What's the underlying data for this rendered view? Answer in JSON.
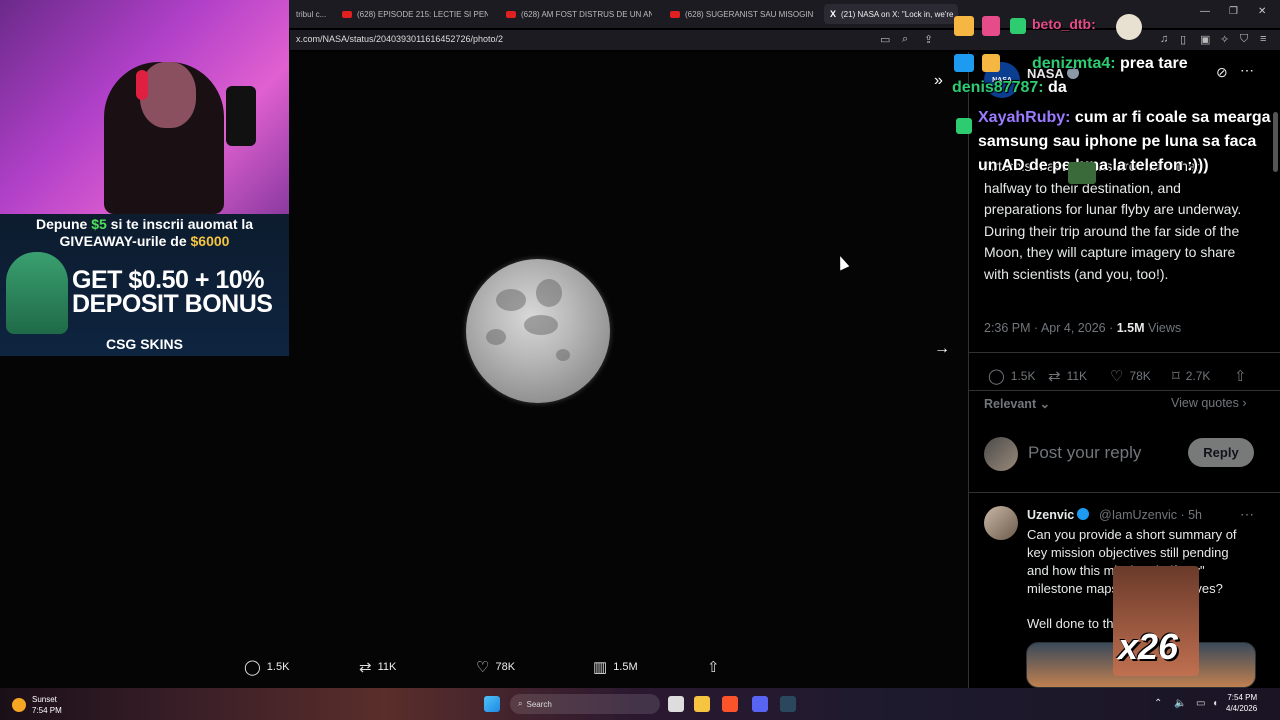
{
  "browser": {
    "tabs": [
      {
        "label": "tribul c..."
      },
      {
        "label": "(628) EPISODE 215: LECTIE SI PENTRU"
      },
      {
        "label": "(628) AM FOST DISTRUS DE UN ANT"
      },
      {
        "label": "(628) SUGERANIST SAU MISOGIN? |"
      },
      {
        "label": "(21) NASA on X: \"Lock in, we're"
      }
    ],
    "url": "x.com/NASA/status/2040393011616452726/photo/2"
  },
  "photo_actions": {
    "replies": "1.5K",
    "reposts": "11K",
    "likes": "78K",
    "views": "1.5M"
  },
  "tweet": {
    "author": "NASA",
    "avatar_text": "NASA",
    "text": "Artemis II astronauts are more than halfway to their destination, and preparations for lunar flyby are underway. During their trip around the far side of the Moon, they will capture imagery to share with scientists (and you, too!).",
    "time": "2:36 PM · Apr 4, 2026 · ",
    "views_count": "1.5M",
    "views_label": " Views",
    "replies": "1.5K",
    "reposts": "11K",
    "likes": "78K",
    "bookmarks": "2.7K",
    "sort_label": "Relevant",
    "view_quotes": "View quotes",
    "reply_placeholder": "Post your reply",
    "reply_button": "Reply"
  },
  "reply": {
    "name": "Uzenvic",
    "handle": "@IamUzenvic · 5h",
    "text": "Can you provide a short summary of key mission objectives still pending and how this mission \"halfway\" milestone maps to the objectives?",
    "text2": "Well done to th..."
  },
  "stream": {
    "promo_line1": "Depune ",
    "promo_amount1": "$5",
    "promo_line1b": " si te inscrii auomat la",
    "promo_line2": "GIVEAWAY-urile de ",
    "promo_amount2": "$6000",
    "promo_big1": "GET $0.50 + 10%",
    "promo_big2": "DEPOSIT BONUS",
    "promo_brand": "CSG SKINS",
    "chat_top_user": "beto_dtb:",
    "chat": [
      {
        "user": "denizmta4:",
        "msg": " prea tare"
      },
      {
        "user": "denis87787:",
        "msg": " da"
      },
      {
        "user": "XayahRuby:",
        "msg": " cum ar fi coale sa mearga samsung sau iphone pe luna sa faca un AD de pe luna la telefon :)))"
      }
    ],
    "combo": "x26"
  },
  "taskbar": {
    "weather_label": "Sunset",
    "weather_time": "7:54 PM",
    "search": "Search",
    "clock_time": "7:54 PM",
    "clock_date": "4/4/2026"
  }
}
